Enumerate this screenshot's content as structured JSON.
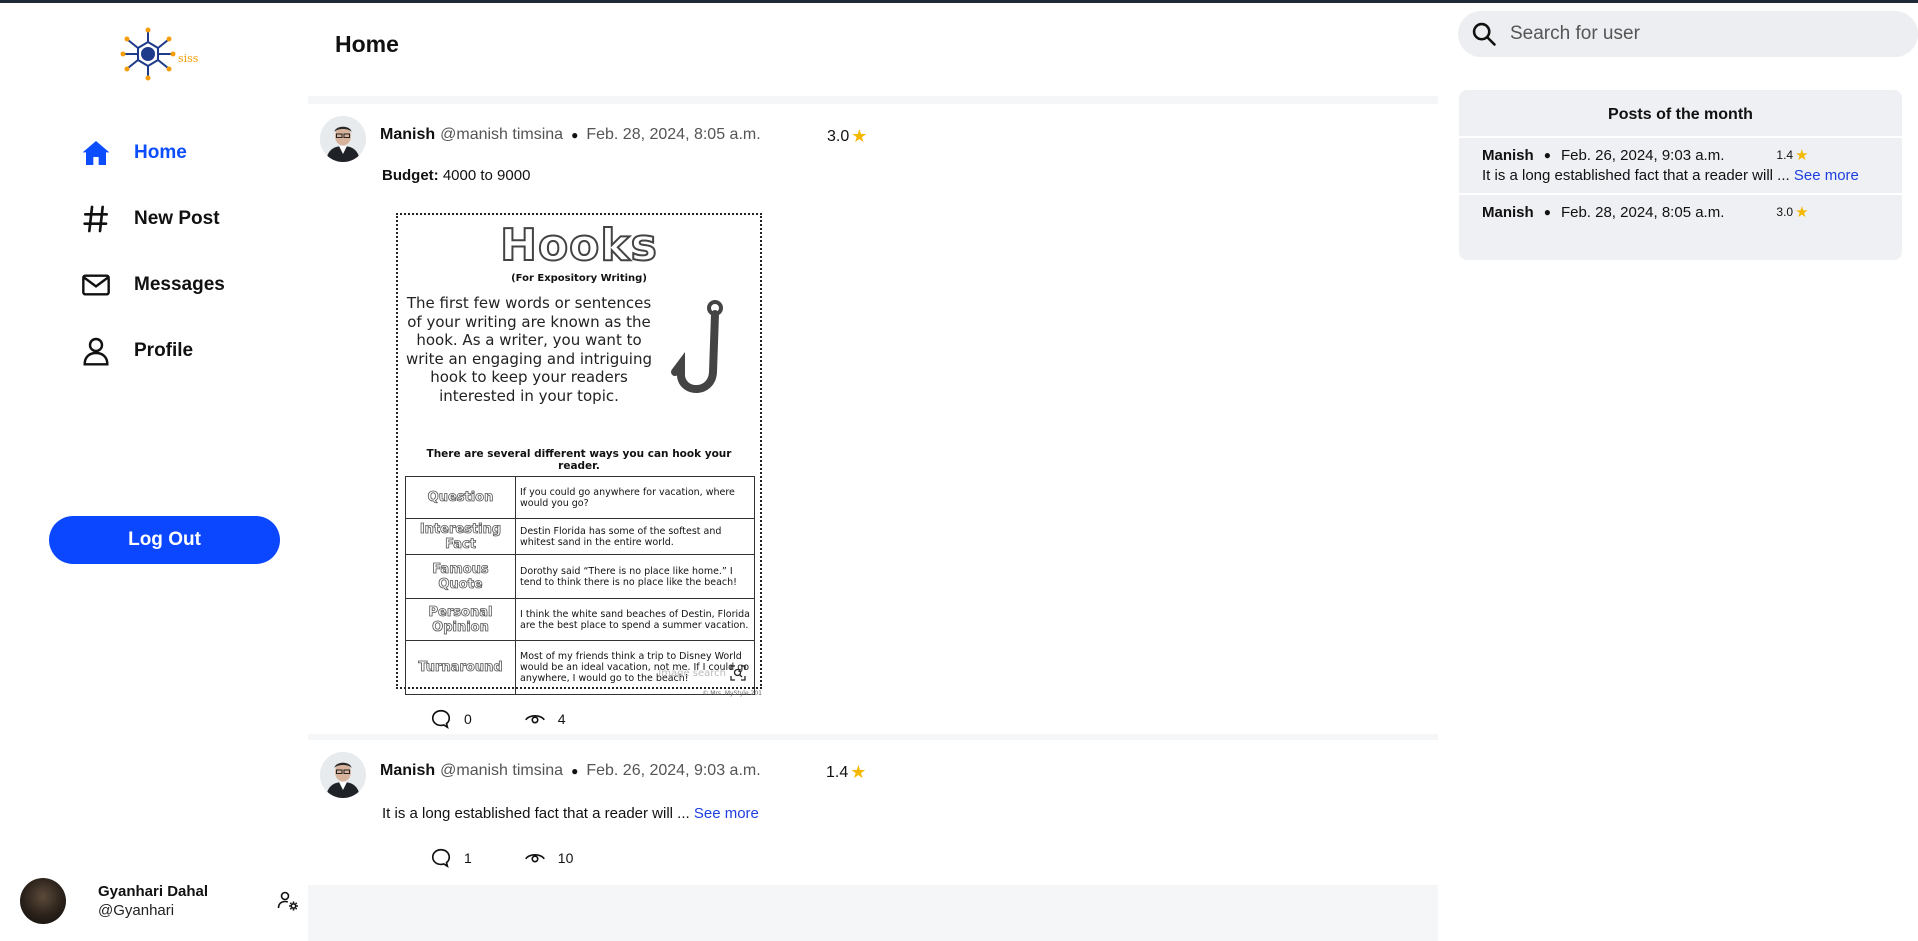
{
  "app": {
    "logo_text": "siss"
  },
  "sidebar": {
    "nav": [
      {
        "label": "Home",
        "icon": "home-icon",
        "active": true
      },
      {
        "label": "New Post",
        "icon": "hash-icon",
        "active": false
      },
      {
        "label": "Messages",
        "icon": "mail-icon",
        "active": false
      },
      {
        "label": "Profile",
        "icon": "user-icon",
        "active": false
      }
    ],
    "logout_label": "Log Out",
    "current_user": {
      "name": "Gyanhari Dahal",
      "handle": "@Gyanhari"
    }
  },
  "main": {
    "title": "Home",
    "posts": [
      {
        "author": "Manish",
        "handle": "@manish timsina",
        "date": "Feb. 28, 2024, 8:05 a.m.",
        "rating": "3.0",
        "budget_label": "Budget:",
        "budget_value": "4000 to 9000",
        "comments": "0",
        "views": "4",
        "image": {
          "title": "Hooks",
          "subtitle": "(For Expository Writing)",
          "intro": "The first few words or sentences of your writing are known as the hook. As a writer, you want to write an engaging and intriguing hook to keep your readers interested in your topic.",
          "ways_heading": "There are several different ways you can hook your reader.",
          "rows": [
            {
              "type": "Question",
              "example": "If you could go anywhere for vacation, where would you go?"
            },
            {
              "type": "Interesting Fact",
              "example": "Destin Florida has some of the softest and whitest sand in the entire world."
            },
            {
              "type": "Famous Quote",
              "example": "Dorothy said “There is no place like home.” I tend to think there is no place like the beach!"
            },
            {
              "type": "Personal Opinion",
              "example": "I think the white sand beaches of Destin, Florida are the best place to spend a summer vacation."
            },
            {
              "type": "Turnaround",
              "example": "Most of my friends think a trip to Disney World would be an ideal vacation, not me. If I could go anywhere, I would go to the beach!"
            }
          ],
          "watermark": "Image search",
          "copyright": "© Mrs. MyStyle 201"
        }
      },
      {
        "author": "Manish",
        "handle": "@manish timsina",
        "date": "Feb. 26, 2024, 9:03 a.m.",
        "rating": "1.4",
        "text": "It is a long established fact that a reader will ...",
        "see_more": "See more",
        "comments": "1",
        "views": "10"
      }
    ]
  },
  "right": {
    "search_placeholder": "Search for user",
    "potm_title": "Posts of the month",
    "potm": [
      {
        "author": "Manish",
        "date": "Feb. 26, 2024, 9:03 a.m.",
        "rating": "1.4",
        "text": "It is a long established fact that a reader will ...",
        "see_more": "See more"
      },
      {
        "author": "Manish",
        "date": "Feb. 28, 2024, 8:05 a.m.",
        "rating": "3.0"
      }
    ]
  },
  "colors": {
    "accent": "#0a47ff",
    "star": "#f5b800",
    "link": "#1d3ee0"
  }
}
